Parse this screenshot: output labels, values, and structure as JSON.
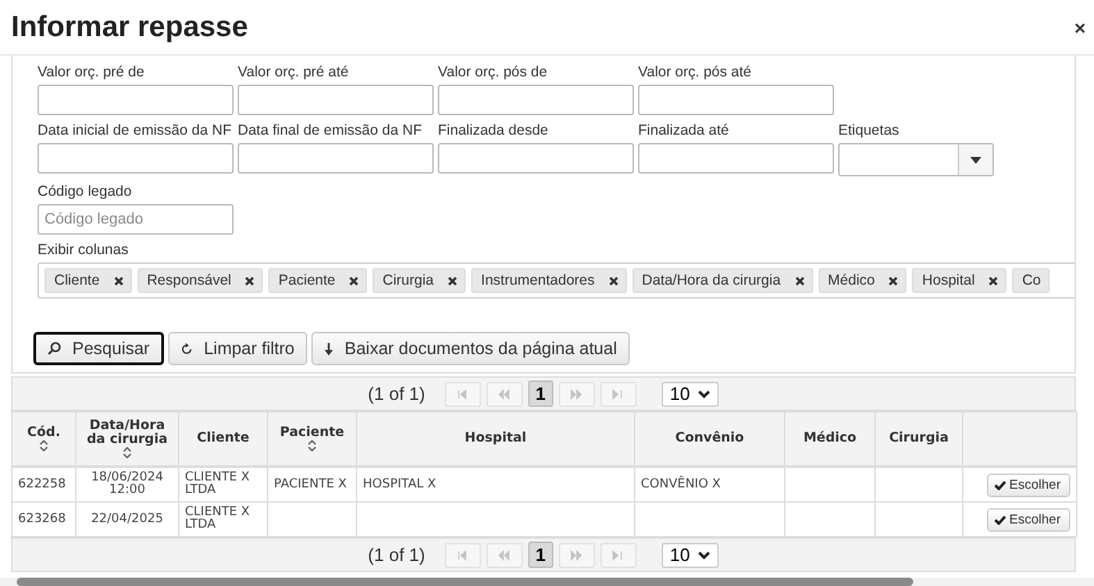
{
  "window": {
    "title": "Informar repasse",
    "close": "×"
  },
  "filters": [
    [
      {
        "label": "Valor orç. pré de",
        "kind": "text"
      },
      {
        "label": "Valor orç. pré até",
        "kind": "text"
      },
      {
        "label": "Valor orç. pós de",
        "kind": "text"
      },
      {
        "label": "Valor orç. pós até",
        "kind": "text"
      }
    ],
    [
      {
        "label": "Data inicial de emissão da NF",
        "kind": "text"
      },
      {
        "label": "Data final de emissão da NF",
        "kind": "text"
      },
      {
        "label": "Finalizada desde",
        "kind": "text"
      },
      {
        "label": "Finalizada até",
        "kind": "text"
      },
      {
        "label": "Etiquetas",
        "kind": "select"
      }
    ],
    [
      {
        "label": "Código legado",
        "kind": "text",
        "placeholder": "Código legado"
      }
    ]
  ],
  "columns_picker": {
    "label": "Exibir colunas",
    "tags": [
      "Cliente",
      "Responsável",
      "Paciente",
      "Cirurgia",
      "Instrumentadores",
      "Data/Hora da cirurgia",
      "Médico",
      "Hospital",
      "Co"
    ]
  },
  "buttons": [
    {
      "label": "Pesquisar",
      "focused": true
    },
    {
      "label": "Limpar filtro",
      "focused": false
    },
    {
      "label": "Baixar documentos da página atual",
      "focused": false
    }
  ],
  "pagers": [
    {
      "status": "(1 of 1)",
      "pages": [
        {
          "label": "1",
          "selected": true
        }
      ],
      "page_size": "10"
    },
    {
      "status": "(1 of 1)",
      "pages": [
        {
          "label": "1",
          "selected": true
        }
      ],
      "page_size": "10"
    }
  ],
  "table": {
    "columns": [
      {
        "label": "Cód.",
        "sortable": true
      },
      {
        "label": "Data/Hora da cirurgia",
        "sortable": true
      },
      {
        "label": "Cliente",
        "sortable": false
      },
      {
        "label": "Paciente",
        "sortable": true
      },
      {
        "label": "Hospital",
        "sortable": false
      },
      {
        "label": "Convênio",
        "sortable": false
      },
      {
        "label": "Médico",
        "sortable": false
      },
      {
        "label": "Cirurgia",
        "sortable": false
      }
    ],
    "rows": [
      {
        "cells": [
          "622258",
          "18/06/2024 12:00",
          "CLIENTE X LTDA",
          "PACIENTE X",
          "HOSPITAL X",
          "CONVÊNIO X",
          null,
          null
        ],
        "action": "Escolher"
      },
      {
        "cells": [
          "623268",
          "22/04/2025",
          "CLIENTE X LTDA",
          null,
          null,
          null,
          null,
          null
        ],
        "action": "Escolher"
      }
    ]
  }
}
